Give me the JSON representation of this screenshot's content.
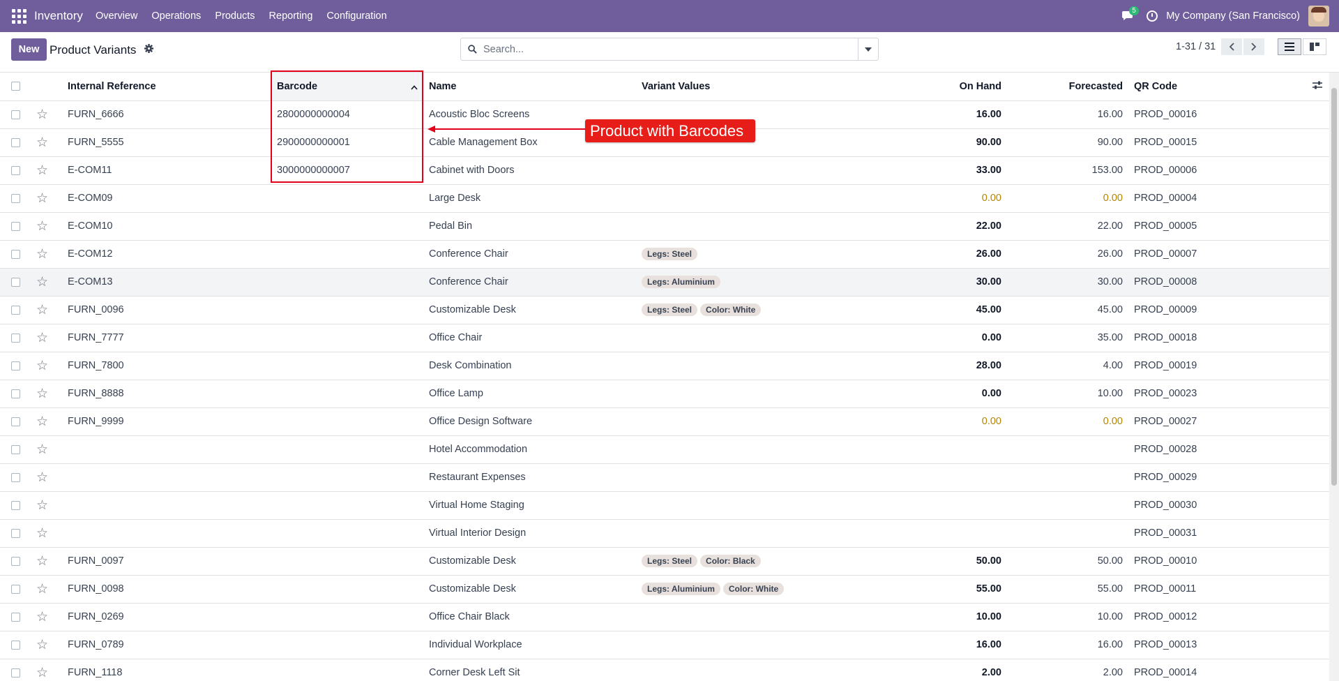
{
  "navbar": {
    "app_name": "Inventory",
    "menu": [
      "Overview",
      "Operations",
      "Products",
      "Reporting",
      "Configuration"
    ],
    "chat_count": "5",
    "company": "My Company (San Francisco)"
  },
  "control": {
    "new_label": "New",
    "title": "Product Variants",
    "search_placeholder": "Search...",
    "pager": "1-31 / 31"
  },
  "columns": {
    "internal_reference": "Internal Reference",
    "barcode": "Barcode",
    "name": "Name",
    "variant_values": "Variant Values",
    "on_hand": "On Hand",
    "forecasted": "Forecasted",
    "qr_code": "QR Code"
  },
  "annotation": "Product with Barcodes",
  "rows": [
    {
      "ref": "FURN_6666",
      "barcode": "2800000000004",
      "name": "Acoustic Bloc Screens",
      "tags": [],
      "on_hand": "16.00",
      "forecasted": "16.00",
      "qr": "PROD_00016",
      "warn": false
    },
    {
      "ref": "FURN_5555",
      "barcode": "2900000000001",
      "name": "Cable Management Box",
      "tags": [],
      "on_hand": "90.00",
      "forecasted": "90.00",
      "qr": "PROD_00015",
      "warn": false
    },
    {
      "ref": "E-COM11",
      "barcode": "3000000000007",
      "name": "Cabinet with Doors",
      "tags": [],
      "on_hand": "33.00",
      "forecasted": "153.00",
      "qr": "PROD_00006",
      "warn": false
    },
    {
      "ref": "E-COM09",
      "barcode": "",
      "name": "Large Desk",
      "tags": [],
      "on_hand": "0.00",
      "forecasted": "0.00",
      "qr": "PROD_00004",
      "warn": true
    },
    {
      "ref": "E-COM10",
      "barcode": "",
      "name": "Pedal Bin",
      "tags": [],
      "on_hand": "22.00",
      "forecasted": "22.00",
      "qr": "PROD_00005",
      "warn": false
    },
    {
      "ref": "E-COM12",
      "barcode": "",
      "name": "Conference Chair",
      "tags": [
        "Legs: Steel"
      ],
      "on_hand": "26.00",
      "forecasted": "26.00",
      "qr": "PROD_00007",
      "warn": false
    },
    {
      "ref": "E-COM13",
      "barcode": "",
      "name": "Conference Chair",
      "tags": [
        "Legs: Aluminium"
      ],
      "on_hand": "30.00",
      "forecasted": "30.00",
      "qr": "PROD_00008",
      "warn": false,
      "highlight": true
    },
    {
      "ref": "FURN_0096",
      "barcode": "",
      "name": "Customizable Desk",
      "tags": [
        "Legs: Steel",
        "Color: White"
      ],
      "on_hand": "45.00",
      "forecasted": "45.00",
      "qr": "PROD_00009",
      "warn": false
    },
    {
      "ref": "FURN_7777",
      "barcode": "",
      "name": "Office Chair",
      "tags": [],
      "on_hand": "0.00",
      "forecasted": "35.00",
      "qr": "PROD_00018",
      "warn": false
    },
    {
      "ref": "FURN_7800",
      "barcode": "",
      "name": "Desk Combination",
      "tags": [],
      "on_hand": "28.00",
      "forecasted": "4.00",
      "qr": "PROD_00019",
      "warn": false
    },
    {
      "ref": "FURN_8888",
      "barcode": "",
      "name": "Office Lamp",
      "tags": [],
      "on_hand": "0.00",
      "forecasted": "10.00",
      "qr": "PROD_00023",
      "warn": false
    },
    {
      "ref": "FURN_9999",
      "barcode": "",
      "name": "Office Design Software",
      "tags": [],
      "on_hand": "0.00",
      "forecasted": "0.00",
      "qr": "PROD_00027",
      "warn": true
    },
    {
      "ref": "",
      "barcode": "",
      "name": "Hotel Accommodation",
      "tags": [],
      "on_hand": "",
      "forecasted": "",
      "qr": "PROD_00028",
      "warn": false
    },
    {
      "ref": "",
      "barcode": "",
      "name": "Restaurant Expenses",
      "tags": [],
      "on_hand": "",
      "forecasted": "",
      "qr": "PROD_00029",
      "warn": false
    },
    {
      "ref": "",
      "barcode": "",
      "name": "Virtual Home Staging",
      "tags": [],
      "on_hand": "",
      "forecasted": "",
      "qr": "PROD_00030",
      "warn": false
    },
    {
      "ref": "",
      "barcode": "",
      "name": "Virtual Interior Design",
      "tags": [],
      "on_hand": "",
      "forecasted": "",
      "qr": "PROD_00031",
      "warn": false
    },
    {
      "ref": "FURN_0097",
      "barcode": "",
      "name": "Customizable Desk",
      "tags": [
        "Legs: Steel",
        "Color: Black"
      ],
      "on_hand": "50.00",
      "forecasted": "50.00",
      "qr": "PROD_00010",
      "warn": false
    },
    {
      "ref": "FURN_0098",
      "barcode": "",
      "name": "Customizable Desk",
      "tags": [
        "Legs: Aluminium",
        "Color: White"
      ],
      "on_hand": "55.00",
      "forecasted": "55.00",
      "qr": "PROD_00011",
      "warn": false
    },
    {
      "ref": "FURN_0269",
      "barcode": "",
      "name": "Office Chair Black",
      "tags": [],
      "on_hand": "10.00",
      "forecasted": "10.00",
      "qr": "PROD_00012",
      "warn": false
    },
    {
      "ref": "FURN_0789",
      "barcode": "",
      "name": "Individual Workplace",
      "tags": [],
      "on_hand": "16.00",
      "forecasted": "16.00",
      "qr": "PROD_00013",
      "warn": false
    },
    {
      "ref": "FURN_1118",
      "barcode": "",
      "name": "Corner Desk Left Sit",
      "tags": [],
      "on_hand": "2.00",
      "forecasted": "2.00",
      "qr": "PROD_00014",
      "warn": false
    }
  ]
}
